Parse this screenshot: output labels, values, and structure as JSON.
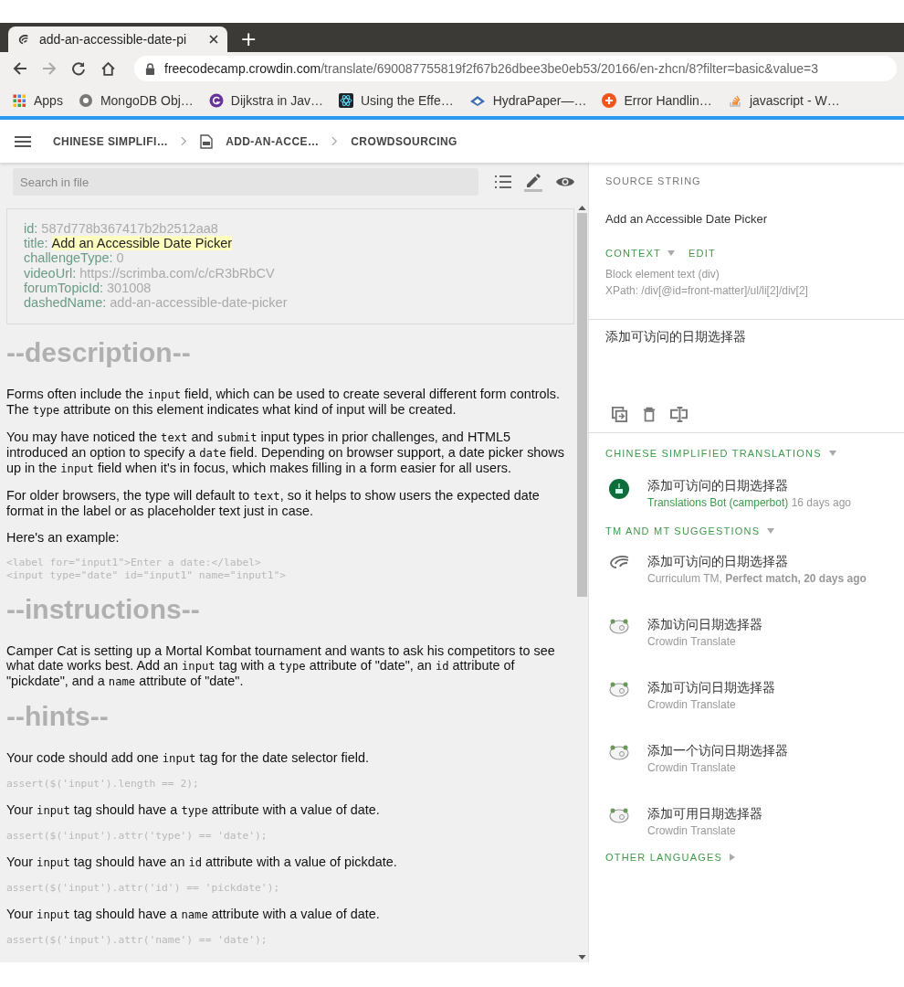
{
  "browser": {
    "tab_title": "add-an-accessible-date-pi",
    "new_tab": "+",
    "address_host": "freecodecamp.crowdin.com",
    "address_path": "/translate/690087755819f2f67b26dbee3be0eb53/20166/en-zhcn/8?filter=basic&value=3",
    "bookmarks": [
      "Apps",
      "MongoDB Obj…",
      "Dijkstra in Jav…",
      "Using the Effe…",
      "HydraPaper—…",
      "Error Handlin…",
      "javascript - W…"
    ]
  },
  "breadcrumb": [
    {
      "label": "CHINESE SIMPLIFI…",
      "kind": "plain"
    },
    {
      "label": "ADD-AN-ACCE…",
      "kind": "file"
    },
    {
      "label": "CROWDSOURCING",
      "kind": "plain"
    }
  ],
  "search": {
    "placeholder": "Search in file"
  },
  "front_matter": [
    {
      "key": "id:",
      "value": "587d778b367417b2b2512aa8",
      "highlighted": false
    },
    {
      "key": "title:",
      "value": "Add an Accessible Date Picker",
      "highlighted": true
    },
    {
      "key": "challengeType:",
      "value": "0",
      "highlighted": false
    },
    {
      "key": "videoUrl:",
      "value": "https://scrimba.com/c/cR3bRbCV",
      "highlighted": false
    },
    {
      "key": "forumTopicId:",
      "value": "301008",
      "highlighted": false
    },
    {
      "key": "dashedName:",
      "value": "add-an-accessible-date-picker",
      "highlighted": false
    }
  ],
  "document": [
    {
      "kind": "heading",
      "text": "--description--"
    },
    {
      "kind": "paragraph",
      "segments": [
        {
          "kind": "text",
          "text": "Forms often include the "
        },
        {
          "kind": "code",
          "text": "input"
        },
        {
          "kind": "text",
          "text": " field, which can be used to create several different form controls. The "
        },
        {
          "kind": "code",
          "text": "type"
        },
        {
          "kind": "text",
          "text": " attribute on this element indicates what kind of input will be created."
        }
      ]
    },
    {
      "kind": "paragraph",
      "segments": [
        {
          "kind": "text",
          "text": "You may have noticed the "
        },
        {
          "kind": "code",
          "text": "text"
        },
        {
          "kind": "text",
          "text": " and "
        },
        {
          "kind": "code",
          "text": "submit"
        },
        {
          "kind": "text",
          "text": " input types in prior challenges, and HTML5 introduced an option to specify a "
        },
        {
          "kind": "code",
          "text": "date"
        },
        {
          "kind": "text",
          "text": " field. Depending on browser support, a date picker shows up in the "
        },
        {
          "kind": "code",
          "text": "input"
        },
        {
          "kind": "text",
          "text": " field when it's in focus, which makes filling in a form easier for all users."
        }
      ]
    },
    {
      "kind": "paragraph",
      "segments": [
        {
          "kind": "text",
          "text": "For older browsers, the type will default to "
        },
        {
          "kind": "code",
          "text": "text"
        },
        {
          "kind": "text",
          "text": ", so it helps to show users the expected date format in the label or as placeholder text just in case."
        }
      ]
    },
    {
      "kind": "paragraph",
      "segments": [
        {
          "kind": "text",
          "text": "Here's an example:"
        }
      ]
    },
    {
      "kind": "code",
      "lines": [
        "<label for=\"input1\">Enter a date:</label>",
        "<input type=\"date\" id=\"input1\" name=\"input1\">"
      ]
    },
    {
      "kind": "heading",
      "text": "--instructions--"
    },
    {
      "kind": "paragraph",
      "segments": [
        {
          "kind": "text",
          "text": "Camper Cat is setting up a Mortal Kombat tournament and wants to ask his competitors to see what date works best. Add an "
        },
        {
          "kind": "code",
          "text": "input"
        },
        {
          "kind": "text",
          "text": " tag with a "
        },
        {
          "kind": "code",
          "text": "type"
        },
        {
          "kind": "text",
          "text": " attribute of \"date\", an "
        },
        {
          "kind": "code",
          "text": "id"
        },
        {
          "kind": "text",
          "text": " attribute of \"pickdate\", and a "
        },
        {
          "kind": "code",
          "text": "name"
        },
        {
          "kind": "text",
          "text": " attribute of \"date\"."
        }
      ]
    },
    {
      "kind": "heading",
      "text": "--hints--"
    },
    {
      "kind": "paragraph",
      "segments": [
        {
          "kind": "text",
          "text": "Your code should add one "
        },
        {
          "kind": "code",
          "text": "input"
        },
        {
          "kind": "text",
          "text": " tag for the date selector field."
        }
      ]
    },
    {
      "kind": "code",
      "lines": [
        "assert($('input').length == 2);"
      ]
    },
    {
      "kind": "paragraph",
      "segments": [
        {
          "kind": "text",
          "text": "Your "
        },
        {
          "kind": "code",
          "text": "input"
        },
        {
          "kind": "text",
          "text": " tag should have a "
        },
        {
          "kind": "code",
          "text": "type"
        },
        {
          "kind": "text",
          "text": " attribute with a value of date."
        }
      ]
    },
    {
      "kind": "code",
      "lines": [
        "assert($('input').attr('type') == 'date');"
      ]
    },
    {
      "kind": "paragraph",
      "segments": [
        {
          "kind": "text",
          "text": "Your "
        },
        {
          "kind": "code",
          "text": "input"
        },
        {
          "kind": "text",
          "text": " tag should have an "
        },
        {
          "kind": "code",
          "text": "id"
        },
        {
          "kind": "text",
          "text": " attribute with a value of pickdate."
        }
      ]
    },
    {
      "kind": "code",
      "lines": [
        "assert($('input').attr('id') == 'pickdate');"
      ]
    },
    {
      "kind": "paragraph",
      "segments": [
        {
          "kind": "text",
          "text": "Your "
        },
        {
          "kind": "code",
          "text": "input"
        },
        {
          "kind": "text",
          "text": " tag should have a "
        },
        {
          "kind": "code",
          "text": "name"
        },
        {
          "kind": "text",
          "text": " attribute with a value of date."
        }
      ]
    },
    {
      "kind": "code",
      "lines": [
        "assert($('input').attr('name') == 'date');"
      ]
    }
  ],
  "source": {
    "heading": "SOURCE STRING",
    "text": "Add an Accessible Date Picker",
    "context_label": "CONTEXT",
    "edit_label": "EDIT",
    "context_lines": [
      "Block element text (div)",
      "XPath: /div[@id=front-matter]/ul/li[2]/div[2]"
    ]
  },
  "translation_value": "添加可访问的日期选择器",
  "translations": {
    "heading": "CHINESE SIMPLIFIED TRANSLATIONS",
    "items": [
      {
        "text": "添加可访问的日期选择器",
        "author": "Translations Bot (camperbot)",
        "time": "16 days ago"
      }
    ]
  },
  "suggestions": {
    "heading": "TM AND MT SUGGESTIONS",
    "items": [
      {
        "kind": "tm",
        "text": "添加可访问的日期选择器",
        "meta": "Curriculum TM, **Perfect match, 20 days ago**"
      },
      {
        "kind": "mt",
        "text": "添加访问日期选择器",
        "meta": "Crowdin Translate"
      },
      {
        "kind": "mt",
        "text": "添加可访问日期选择器",
        "meta": "Crowdin Translate"
      },
      {
        "kind": "mt",
        "text": "添加一个访问日期选择器",
        "meta": "Crowdin Translate"
      },
      {
        "kind": "mt",
        "text": "添加可用日期选择器",
        "meta": "Crowdin Translate"
      }
    ]
  },
  "other_languages": {
    "heading": "OTHER LANGUAGES"
  }
}
